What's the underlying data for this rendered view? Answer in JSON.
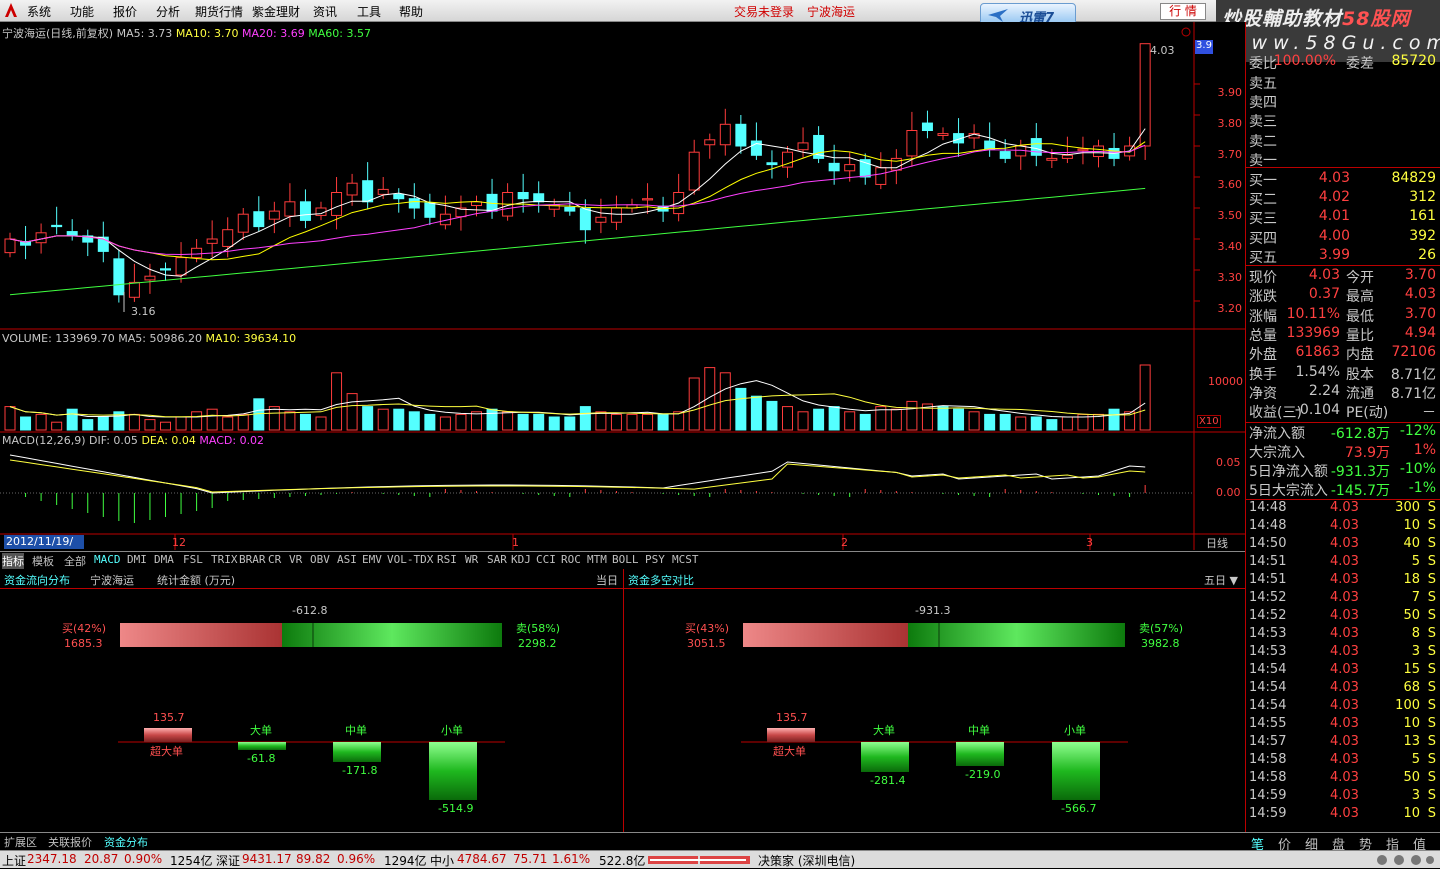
{
  "menu": {
    "items": [
      "系统",
      "功能",
      "报价",
      "分析",
      "期货行情",
      "紫金理财",
      "资讯",
      "工具",
      "帮助"
    ],
    "login_status": "交易未登录",
    "stock_link": "宁波海运",
    "xunlei": "迅雷7",
    "hq_button": "行 情"
  },
  "watermark": {
    "line1_a": "炒股輔助教材",
    "line1_b": "58股网",
    "line2": "www.58Gu.com"
  },
  "chart": {
    "title": "宁波海运(日线,前复权)",
    "ma5": "MA5: 3.73",
    "ma10": "MA10: 3.70",
    "ma20": "MA20: 3.69",
    "ma60": "MA60: 3.57",
    "price_axis": [
      "3.90",
      "3.80",
      "3.70",
      "3.60",
      "3.50",
      "3.40",
      "3.30",
      "3.20"
    ],
    "high_label": "4.03",
    "low_label": "3.16",
    "last_tag": "3.9",
    "volume": "VOLUME: 133969.70",
    "vol_ma5": "MA5: 50986.20",
    "vol_ma10": "MA10: 39634.10",
    "vol_axis": "10000",
    "vol_unit": "X10",
    "macd": "MACD(12,26,9)",
    "dif": "DIF: 0.05",
    "dea": "DEA: 0.04",
    "macd_v": "MACD: 0.02",
    "macd_axis": [
      "0.05",
      "0.00"
    ],
    "date_box": "2012/11/19/一",
    "month_labels": [
      "12",
      "1",
      "2",
      "3"
    ],
    "period": "日线"
  },
  "colors": {
    "up": "#ff3c3c",
    "down": "#54ffff",
    "ma5": "#ffffff",
    "ma10": "#ffff00",
    "ma20": "#ff40ff",
    "ma60": "#40ff40"
  },
  "indicator_tabs": [
    "指标",
    "模板",
    "全部",
    "MACD",
    "DMI",
    "DMA",
    "FSL",
    "TRIX",
    "BRAR",
    "CR",
    "VR",
    "OBV",
    "ASI",
    "EMV",
    "VOL-TDX",
    "RSI",
    "WR",
    "SAR",
    "KDJ",
    "CCI",
    "ROC",
    "MTM",
    "BOLL",
    "PSY",
    "MCST"
  ],
  "fund": {
    "left_title": "资金流向分布",
    "stock": "宁波海运",
    "stat": "统计金额 (万元)",
    "day_label": "当日",
    "right_title": "资金多空对比",
    "five_day": "五日 ▼",
    "left_net": "-612.8",
    "left_buy": "买(42%)",
    "left_buy_v": "1685.3",
    "left_sell": "卖(58%)",
    "left_sell_v": "2298.2",
    "right_net": "-931.3",
    "right_buy": "买(43%)",
    "right_buy_v": "3051.5",
    "right_sell": "卖(57%)",
    "right_sell_v": "3982.8",
    "cats": [
      "超大单",
      "大单",
      "中单",
      "小单"
    ],
    "left_vals": [
      "135.7",
      "-61.8",
      "-171.8",
      "-514.9"
    ],
    "right_vals": [
      "135.7",
      "-281.4",
      "-219.0",
      "-566.7"
    ]
  },
  "bottom_tabs": [
    "扩展区",
    "关联报价",
    "资金分布"
  ],
  "orderbook": {
    "top_l": "委比",
    "top_v": "100.00%",
    "top_l2": "委差",
    "top_v2": "85720",
    "sells": [
      "卖五",
      "卖四",
      "卖三",
      "卖二",
      "卖一"
    ],
    "buys": [
      [
        "买一",
        "4.03",
        "84829"
      ],
      [
        "买二",
        "4.02",
        "312"
      ],
      [
        "买三",
        "4.01",
        "161"
      ],
      [
        "买四",
        "4.00",
        "392"
      ],
      [
        "买五",
        "3.99",
        "26"
      ]
    ]
  },
  "stats": [
    [
      "现价",
      "4.03",
      "今开",
      "3.70"
    ],
    [
      "涨跌",
      "0.37",
      "最高",
      "4.03"
    ],
    [
      "涨幅",
      "10.11%",
      "最低",
      "3.70"
    ],
    [
      "总量",
      "133969",
      "量比",
      "4.94"
    ],
    [
      "外盘",
      "61863",
      "内盘",
      "72106"
    ],
    [
      "换手",
      "1.54%",
      "股本",
      "8.71亿"
    ],
    [
      "净资",
      "2.24",
      "流通",
      "8.71亿"
    ],
    [
      "收益(三)",
      "-0.104",
      "PE(动)",
      "－"
    ]
  ],
  "flows": [
    [
      "净流入额",
      "-612.8万",
      "-12%"
    ],
    [
      "大宗流入",
      "73.9万",
      "1%"
    ],
    [
      "5日净流入额",
      "-931.3万",
      "-10%"
    ],
    [
      "5日大宗流入",
      "-145.7万",
      "-1%"
    ]
  ],
  "ticks": [
    [
      "14:48",
      "4.03",
      "300",
      "S"
    ],
    [
      "14:48",
      "4.03",
      "10",
      "S"
    ],
    [
      "14:50",
      "4.03",
      "40",
      "S"
    ],
    [
      "14:51",
      "4.03",
      "5",
      "S"
    ],
    [
      "14:51",
      "4.03",
      "18",
      "S"
    ],
    [
      "14:52",
      "4.03",
      "7",
      "S"
    ],
    [
      "14:52",
      "4.03",
      "50",
      "S"
    ],
    [
      "14:53",
      "4.03",
      "8",
      "S"
    ],
    [
      "14:53",
      "4.03",
      "3",
      "S"
    ],
    [
      "14:54",
      "4.03",
      "15",
      "S"
    ],
    [
      "14:54",
      "4.03",
      "68",
      "S"
    ],
    [
      "14:54",
      "4.03",
      "100",
      "S"
    ],
    [
      "14:55",
      "4.03",
      "10",
      "S"
    ],
    [
      "14:57",
      "4.03",
      "13",
      "S"
    ],
    [
      "14:58",
      "4.03",
      "5",
      "S"
    ],
    [
      "14:58",
      "4.03",
      "50",
      "S"
    ],
    [
      "14:59",
      "4.03",
      "3",
      "S"
    ],
    [
      "14:59",
      "4.03",
      "10",
      "S"
    ]
  ],
  "right_tabs": [
    "笔",
    "价",
    "细",
    "盘",
    "势",
    "指",
    "值"
  ],
  "status": {
    "sh_l": "上证",
    "sh_v": "2347.18",
    "sh_c": "20.87",
    "sh_p": "0.90%",
    "sh_a": "1254亿",
    "sz_l": "深证",
    "sz_v": "9431.17",
    "sz_c": "89.82",
    "sz_p": "0.96%",
    "sz_a": "1294亿",
    "zx_l": "中小",
    "zx_v": "4784.67",
    "zx_c": "75.71",
    "zx_p": "1.61%",
    "zx_a": "522.8亿",
    "broker": "决策家 (深圳电信)"
  }
}
